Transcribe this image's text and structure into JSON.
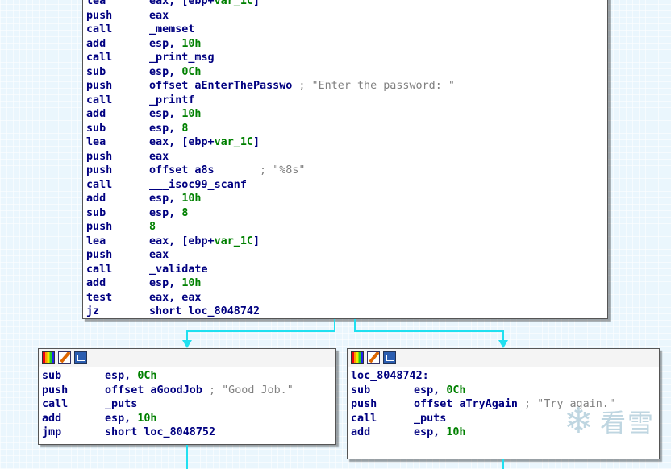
{
  "top_block": {
    "lines": [
      {
        "mn": "lea",
        "op": "eax, [ebp+",
        "var": "var_1C",
        "tail": "]",
        "cm": ""
      },
      {
        "mn": "push",
        "op": "eax",
        "var": "",
        "tail": "",
        "cm": ""
      },
      {
        "mn": "call",
        "op": "_memset",
        "var": "",
        "tail": "",
        "cm": ""
      },
      {
        "mn": "add",
        "op": "esp, ",
        "var": "",
        "num": "10h",
        "tail": "",
        "cm": ""
      },
      {
        "mn": "call",
        "op": "_print_msg",
        "var": "",
        "tail": "",
        "cm": ""
      },
      {
        "mn": "sub",
        "op": "esp, ",
        "var": "",
        "num": "0Ch",
        "tail": "",
        "cm": ""
      },
      {
        "mn": "push",
        "op": "offset aEnterThePasswo",
        "var": "",
        "tail": "",
        "cm": " ; \"Enter the password: \""
      },
      {
        "mn": "call",
        "op": "_printf",
        "var": "",
        "tail": "",
        "cm": ""
      },
      {
        "mn": "add",
        "op": "esp, ",
        "var": "",
        "num": "10h",
        "tail": "",
        "cm": ""
      },
      {
        "mn": "sub",
        "op": "esp, ",
        "var": "",
        "num": "8",
        "tail": "",
        "cm": ""
      },
      {
        "mn": "lea",
        "op": "eax, [ebp+",
        "var": "var_1C",
        "tail": "]",
        "cm": ""
      },
      {
        "mn": "push",
        "op": "eax",
        "var": "",
        "tail": "",
        "cm": ""
      },
      {
        "mn": "push",
        "op": "offset a8s",
        "var": "",
        "tail": "",
        "cm": "       ; \"%8s\""
      },
      {
        "mn": "call",
        "op": "___isoc99_scanf",
        "var": "",
        "tail": "",
        "cm": ""
      },
      {
        "mn": "add",
        "op": "esp, ",
        "var": "",
        "num": "10h",
        "tail": "",
        "cm": ""
      },
      {
        "mn": "sub",
        "op": "esp, ",
        "var": "",
        "num": "8",
        "tail": "",
        "cm": ""
      },
      {
        "mn": "push",
        "op": "",
        "var": "",
        "num": "8",
        "tail": "",
        "cm": ""
      },
      {
        "mn": "lea",
        "op": "eax, [ebp+",
        "var": "var_1C",
        "tail": "]",
        "cm": ""
      },
      {
        "mn": "push",
        "op": "eax",
        "var": "",
        "tail": "",
        "cm": ""
      },
      {
        "mn": "call",
        "op": "_validate",
        "var": "",
        "tail": "",
        "cm": ""
      },
      {
        "mn": "add",
        "op": "esp, ",
        "var": "",
        "num": "10h",
        "tail": "",
        "cm": ""
      },
      {
        "mn": "test",
        "op": "eax, eax",
        "var": "",
        "tail": "",
        "cm": ""
      },
      {
        "mn": "jz",
        "op": "short loc_8048742",
        "var": "",
        "tail": "",
        "cm": ""
      }
    ]
  },
  "left_block": {
    "label": "",
    "lines": [
      {
        "mn": "sub",
        "op": "esp, ",
        "num": "0Ch",
        "cm": ""
      },
      {
        "mn": "push",
        "op": "offset aGoodJob",
        "num": "",
        "cm": " ; \"Good Job.\""
      },
      {
        "mn": "call",
        "op": "_puts",
        "num": "",
        "cm": ""
      },
      {
        "mn": "add",
        "op": "esp, ",
        "num": "10h",
        "cm": ""
      },
      {
        "mn": "jmp",
        "op": "short loc_8048752",
        "num": "",
        "cm": ""
      }
    ]
  },
  "right_block": {
    "label": "loc_8048742:",
    "lines": [
      {
        "mn": "sub",
        "op": "esp, ",
        "num": "0Ch",
        "cm": ""
      },
      {
        "mn": "push",
        "op": "offset aTryAgain",
        "num": "",
        "cm": " ; \"Try again.\""
      },
      {
        "mn": "call",
        "op": "_puts",
        "num": "",
        "cm": ""
      },
      {
        "mn": "add",
        "op": "esp, ",
        "num": "10h",
        "cm": ""
      }
    ]
  },
  "toolbar_icons": [
    "color-palette-icon",
    "edit-pencil-icon",
    "graph-view-icon"
  ],
  "colors": {
    "edge": "#20e0f0",
    "mnemonic": "#000080",
    "immediate": "#008000",
    "comment": "#808080"
  },
  "watermark": {
    "text": "看雪",
    "glyph": "❄"
  }
}
